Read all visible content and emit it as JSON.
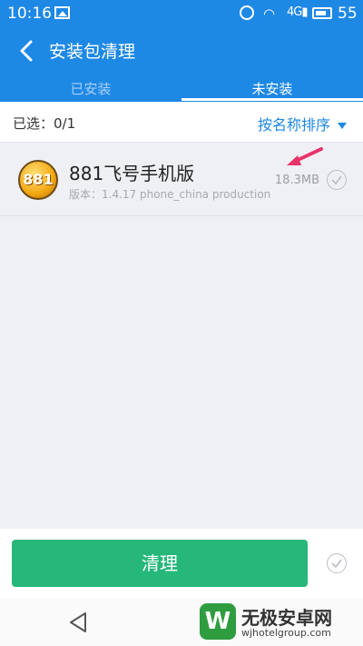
{
  "status_bar": {
    "time": "10:16",
    "signal_label": "4G",
    "battery": "55"
  },
  "header": {
    "title": "安装包清理"
  },
  "tabs": [
    {
      "label": "已安装"
    },
    {
      "label": "未安装"
    }
  ],
  "filter": {
    "selected_label": "已选：0/1",
    "sort_label": "按名称排序"
  },
  "packages": [
    {
      "icon_text": "881",
      "name": "881飞号手机版",
      "version": "版本：1.4.17 phone_china production",
      "size": "18.3MB"
    }
  ],
  "actions": {
    "clean_label": "清理"
  },
  "watermark": {
    "name": "无极安卓网",
    "url": "wjhotelgroup.com"
  },
  "colors": {
    "primary": "#1e88e5",
    "clean_button": "#26b77a",
    "pointer_arrow": "#e8336b"
  }
}
